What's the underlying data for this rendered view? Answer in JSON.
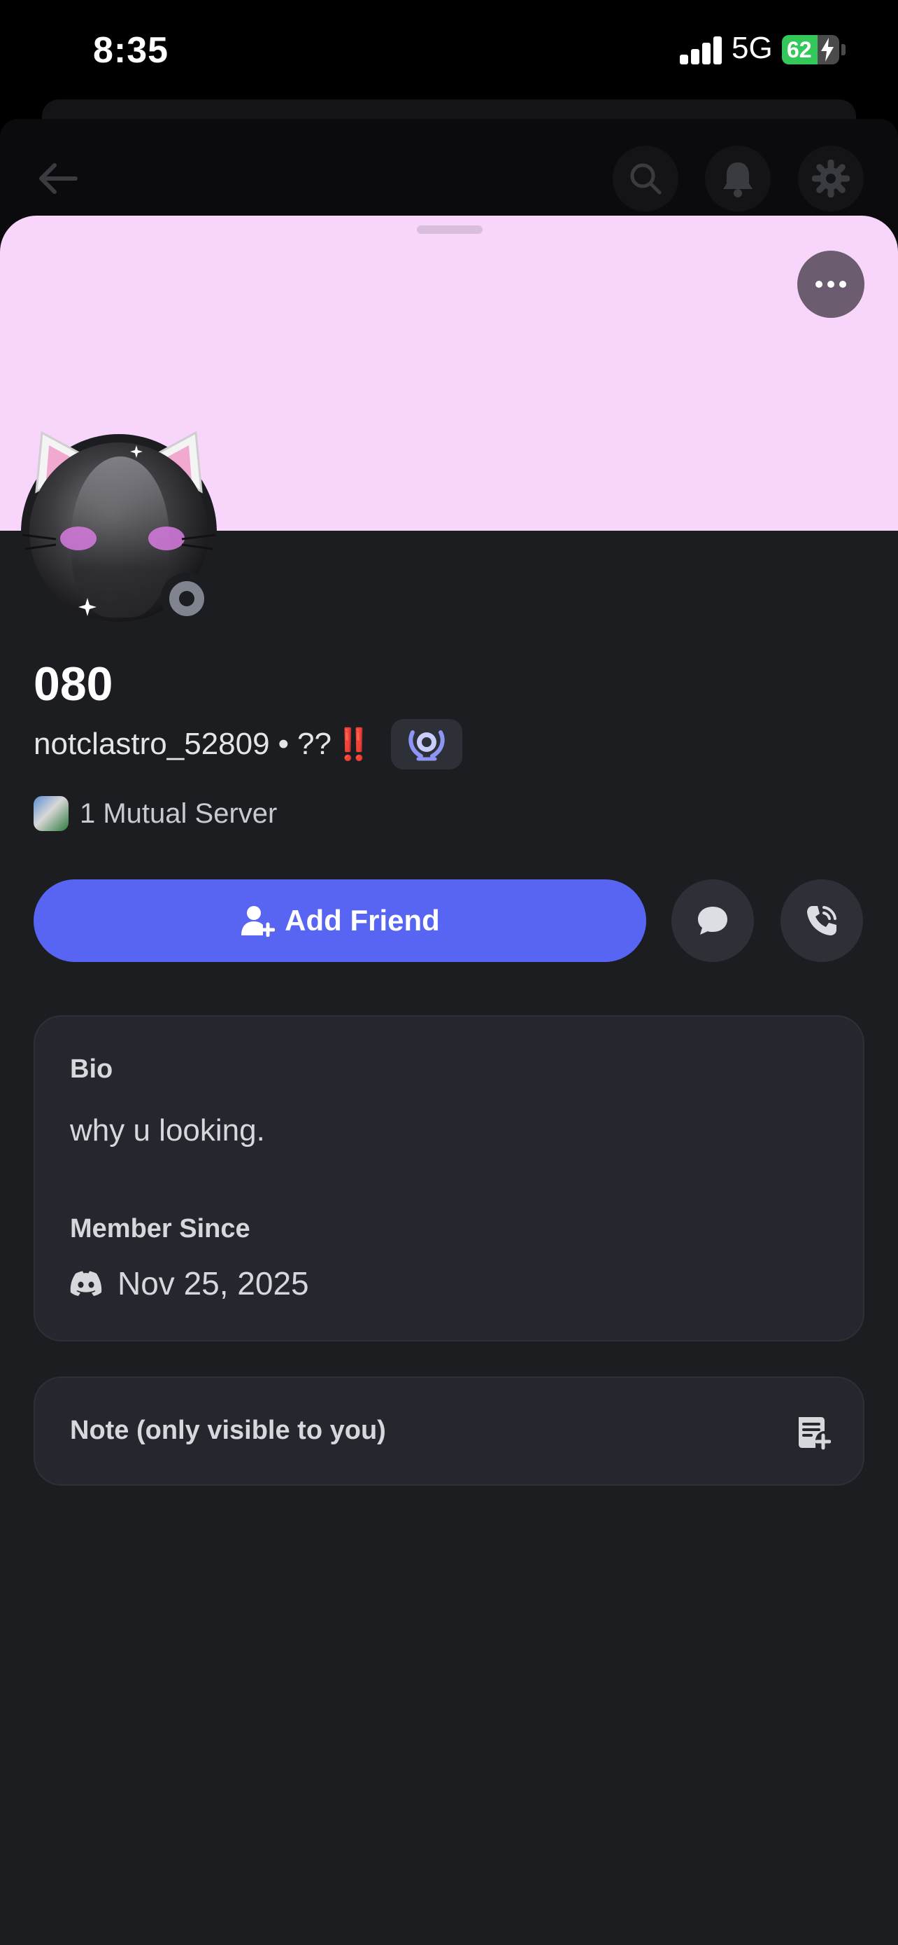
{
  "status_bar": {
    "time": "8:35",
    "network": "5G",
    "battery": "62",
    "battery_level": 0.62
  },
  "profile": {
    "display_name": "080",
    "username": "notclastro_52809",
    "separator": "•",
    "pronouns": "??",
    "pronouns_emoji": "‼️",
    "mutual_servers": "1 Mutual Server",
    "banner_color": "#f8d6fc",
    "status": "offline"
  },
  "actions": {
    "add_friend": "Add Friend",
    "message_icon": "chat-bubble-icon",
    "call_icon": "phone-call-icon",
    "accent": "#5865f2"
  },
  "bio_card": {
    "bio_label": "Bio",
    "bio_text": "why u looking.",
    "member_since_label": "Member Since",
    "member_since_date": "Nov 25, 2025"
  },
  "note_card": {
    "label": "Note (only visible to you)"
  }
}
